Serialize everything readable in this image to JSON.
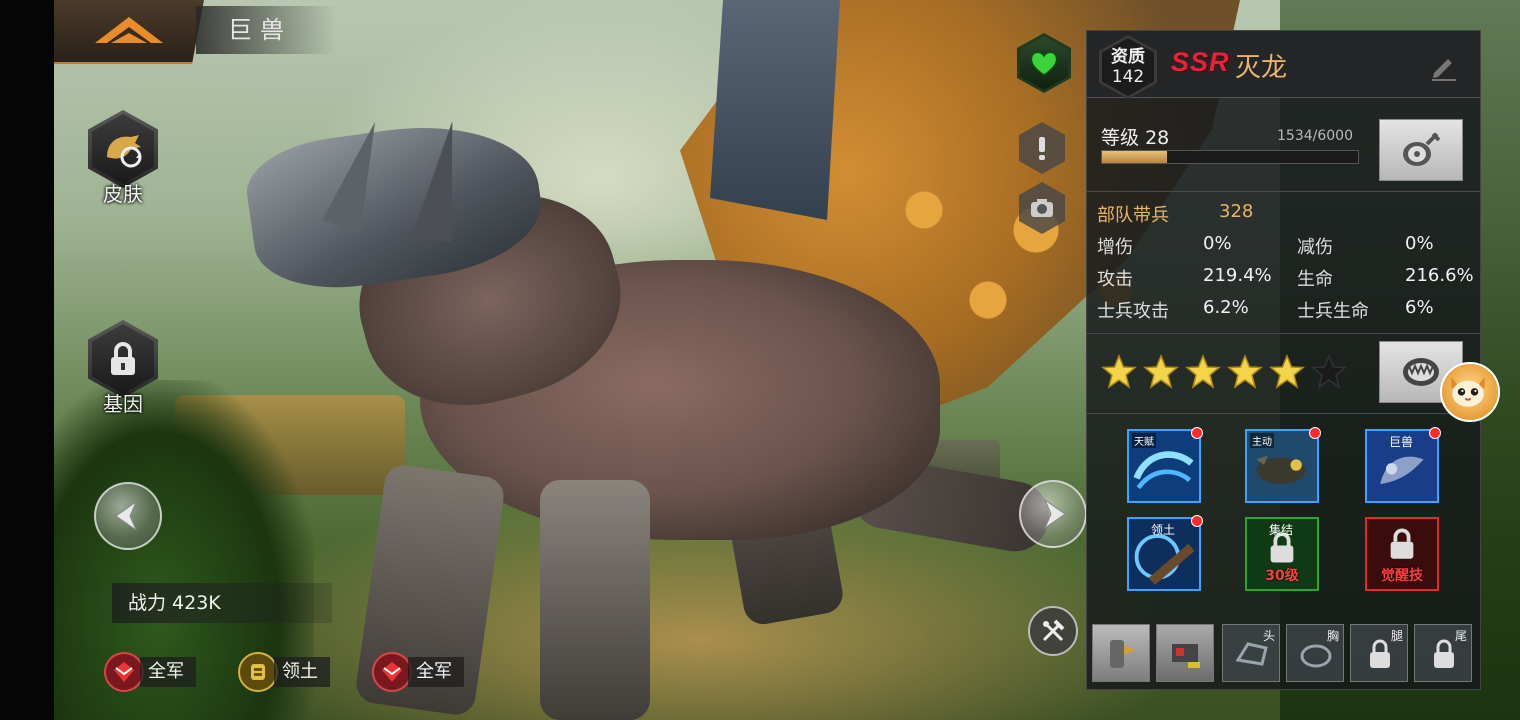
{
  "header": {
    "title": "巨兽"
  },
  "side_buttons": {
    "skin_label": "皮肤",
    "gene_label": "基因"
  },
  "power": {
    "text": "战力 423K"
  },
  "chips": [
    {
      "label": "全军",
      "icon": "army-emblem-icon",
      "color": "#b4232e"
    },
    {
      "label": "领土",
      "icon": "territory-emblem-icon",
      "color": "#c9a020"
    },
    {
      "label": "全军",
      "icon": "army-emblem-icon",
      "color": "#b4232e"
    }
  ],
  "beast": {
    "quality_label": "资质",
    "quality_value": "142",
    "rarity": "SSR",
    "name": "灭龙",
    "level_label": "等级",
    "level": "28",
    "exp_text": "1534/6000",
    "exp_current": 1534,
    "exp_max": 6000,
    "stars_filled": 5,
    "stars_total": 6
  },
  "stats": {
    "troop_label": "部队带兵",
    "troop_value": "328",
    "rows": [
      {
        "l1": "增伤",
        "v1": "0%",
        "l2": "减伤",
        "v2": "0%"
      },
      {
        "l1": "攻击",
        "v1": "219.4%",
        "l2": "生命",
        "v2": "216.6%"
      },
      {
        "l1": "士兵攻击",
        "v1": "6.2%",
        "l2": "士兵生命",
        "v2": "6%"
      }
    ]
  },
  "skills": [
    {
      "tag": "天赋",
      "locked": false,
      "red_dot": true,
      "lock_text": ""
    },
    {
      "tag": "主动",
      "locked": false,
      "red_dot": true,
      "lock_text": ""
    },
    {
      "tag": "巨兽",
      "locked": false,
      "red_dot": true,
      "lock_text": ""
    },
    {
      "tag": "领土",
      "locked": false,
      "red_dot": true,
      "lock_text": ""
    },
    {
      "tag": "集结",
      "locked": true,
      "red_dot": false,
      "lock_text": "30级"
    },
    {
      "tag": "",
      "locked": true,
      "red_dot": false,
      "lock_text": "觉醒技"
    }
  ],
  "equipment": [
    {
      "slot": "",
      "icon": "claw-gear-icon"
    },
    {
      "slot": "",
      "icon": "cannon-gear-icon"
    },
    {
      "slot": "头",
      "icon": "head-armor-icon"
    },
    {
      "slot": "胸",
      "icon": "chest-armor-icon"
    },
    {
      "slot": "腿",
      "icon": "lock-icon"
    },
    {
      "slot": "尾",
      "icon": "lock-icon"
    }
  ],
  "colors": {
    "accent_gold": "#e9b56a",
    "rarity_red": "#e8213a",
    "heart_green": "#3bd43b",
    "notify_red": "#ff2a2a"
  }
}
